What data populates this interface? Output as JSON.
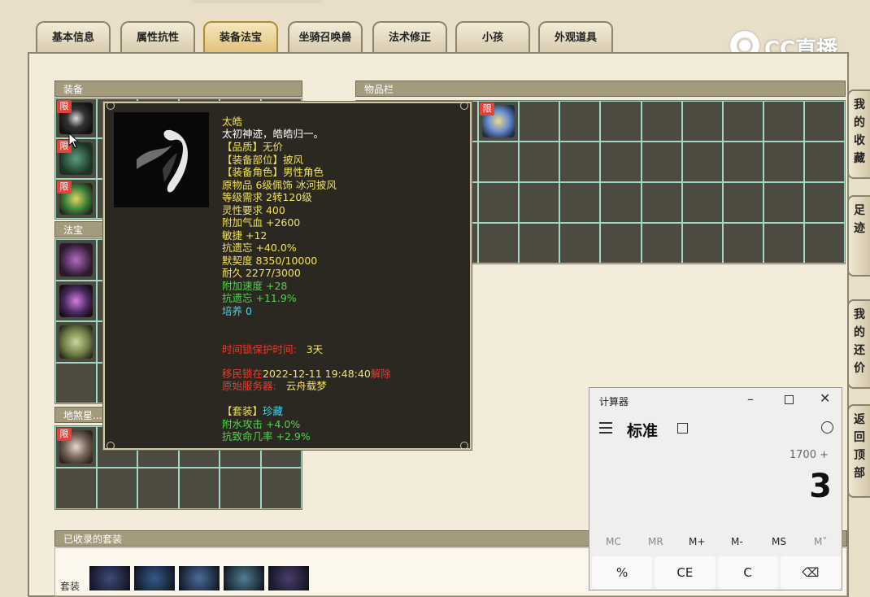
{
  "tabs": [
    "基本信息",
    "属性抗性",
    "装备法宝",
    "坐骑召唤兽",
    "法术修正",
    "小孩",
    "外观道具"
  ],
  "active_tab": 2,
  "watermark": "CC直播",
  "panels": {
    "equip": "装备",
    "fabao": "法宝",
    "disha": "地煞星...",
    "items": "物品栏",
    "suits": "已收录的套装"
  },
  "badge": "限",
  "side_buttons": [
    "我的收藏",
    "足迹",
    "我的还价",
    "返回顶部"
  ],
  "suits_row_label": "套装",
  "tooltip": {
    "name": "太皓",
    "desc": "太初神迹，皓皓归一。",
    "quality": "【品质】无价",
    "slot": "【装备部位】披风",
    "role": "【装备角色】男性角色",
    "origin": "原物品 6级佩饰 冰河披风",
    "level_req": "等级需求 2转120级",
    "spirit_req": "灵性要求 400",
    "hp": "附加气血 +2600",
    "agi": "敏捷 +12",
    "anti_forget": "抗遗忘 +40.0%",
    "tacit": "默契度 8350/10000",
    "durability": "耐久 2277/3000",
    "speed": "附加速度 +28",
    "anti_forget2": "抗遗忘 +11.9%",
    "cultivate": "培养 0",
    "lock_label": "时间锁保护时间:",
    "lock_value": "3天",
    "migrate_a": "移民锁在",
    "migrate_time": "2022-12-11 19:48:40",
    "migrate_b": "解除",
    "server_label": "原始服务器:",
    "server_value": "云舟载梦",
    "suit_label": "【套装】",
    "suit_name": "珍藏",
    "water_attack": "附水攻击 +4.0%",
    "anti_crit": "抗致命几率 +2.9%"
  },
  "calculator": {
    "title": "计算器",
    "mode": "标准",
    "expression": "1700 +",
    "display": "3",
    "memory": [
      "MC",
      "MR",
      "M+",
      "M-",
      "MS",
      "M˅"
    ],
    "keys": [
      "%",
      "CE",
      "C",
      "⌫"
    ]
  }
}
